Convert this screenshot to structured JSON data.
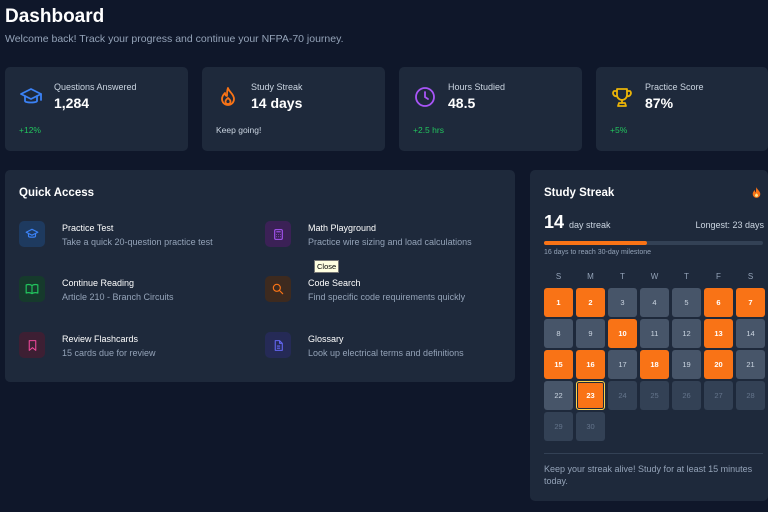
{
  "header": {
    "title": "Dashboard",
    "subtitle": "Welcome back! Track your progress and continue your NFPA-70 journey."
  },
  "stats": [
    {
      "label": "Questions Answered",
      "value": "1,284",
      "delta": "+12%",
      "icon": "graduation-cap-icon",
      "color": "#3b82f6"
    },
    {
      "label": "Study Streak",
      "value": "14 days",
      "delta": "Keep going!",
      "icon": "flame-icon",
      "color": "#f97316"
    },
    {
      "label": "Hours Studied",
      "value": "48.5",
      "delta": "+2.5 hrs",
      "icon": "clock-icon",
      "color": "#a855f7"
    },
    {
      "label": "Practice Score",
      "value": "87%",
      "delta": "+5%",
      "icon": "trophy-icon",
      "color": "#eab308"
    }
  ],
  "quick_access": {
    "title": "Quick Access",
    "items": [
      {
        "name": "Practice Test",
        "desc": "Take a quick 20-question practice test",
        "icon": "graduation-cap-icon",
        "color": "#3b82f6"
      },
      {
        "name": "Math Playground",
        "desc": "Practice wire sizing and load calculations",
        "icon": "calculator-icon",
        "color": "#a855f7"
      },
      {
        "name": "Continue Reading",
        "desc": "Article 210 - Branch Circuits",
        "icon": "book-icon",
        "color": "#22c55e"
      },
      {
        "name": "Code Search",
        "desc": "Find specific code requirements quickly",
        "icon": "search-icon",
        "color": "#f97316"
      },
      {
        "name": "Review Flashcards",
        "desc": "15 cards due for review",
        "icon": "bookmark-icon",
        "color": "#ec4899"
      },
      {
        "name": "Glossary",
        "desc": "Look up electrical terms and definitions",
        "icon": "document-icon",
        "color": "#6366f1"
      }
    ]
  },
  "tooltip": "Close",
  "streak": {
    "title": "Study Streak",
    "count": "14",
    "unit": "day streak",
    "longest": "Longest: 23 days",
    "progress": 0.47,
    "milestone": "16 days to reach 30-day milestone",
    "weekdays": [
      "S",
      "M",
      "T",
      "W",
      "T",
      "F",
      "S"
    ],
    "days": [
      {
        "n": "1",
        "s": "done"
      },
      {
        "n": "2",
        "s": "done"
      },
      {
        "n": "3",
        "s": "past"
      },
      {
        "n": "4",
        "s": "past"
      },
      {
        "n": "5",
        "s": "past"
      },
      {
        "n": "6",
        "s": "done"
      },
      {
        "n": "7",
        "s": "done"
      },
      {
        "n": "8",
        "s": "past"
      },
      {
        "n": "9",
        "s": "past"
      },
      {
        "n": "10",
        "s": "done"
      },
      {
        "n": "11",
        "s": "past"
      },
      {
        "n": "12",
        "s": "past"
      },
      {
        "n": "13",
        "s": "done"
      },
      {
        "n": "14",
        "s": "past"
      },
      {
        "n": "15",
        "s": "done"
      },
      {
        "n": "16",
        "s": "done"
      },
      {
        "n": "17",
        "s": "past"
      },
      {
        "n": "18",
        "s": "done"
      },
      {
        "n": "19",
        "s": "past"
      },
      {
        "n": "20",
        "s": "done"
      },
      {
        "n": "21",
        "s": "past"
      },
      {
        "n": "22",
        "s": "past"
      },
      {
        "n": "23",
        "s": "today"
      },
      {
        "n": "24",
        "s": "future"
      },
      {
        "n": "25",
        "s": "future"
      },
      {
        "n": "26",
        "s": "future"
      },
      {
        "n": "27",
        "s": "future"
      },
      {
        "n": "28",
        "s": "future"
      },
      {
        "n": "29",
        "s": "future"
      },
      {
        "n": "30",
        "s": "future"
      }
    ],
    "footer": "Keep your streak alive! Study for at least 15 minutes today."
  }
}
